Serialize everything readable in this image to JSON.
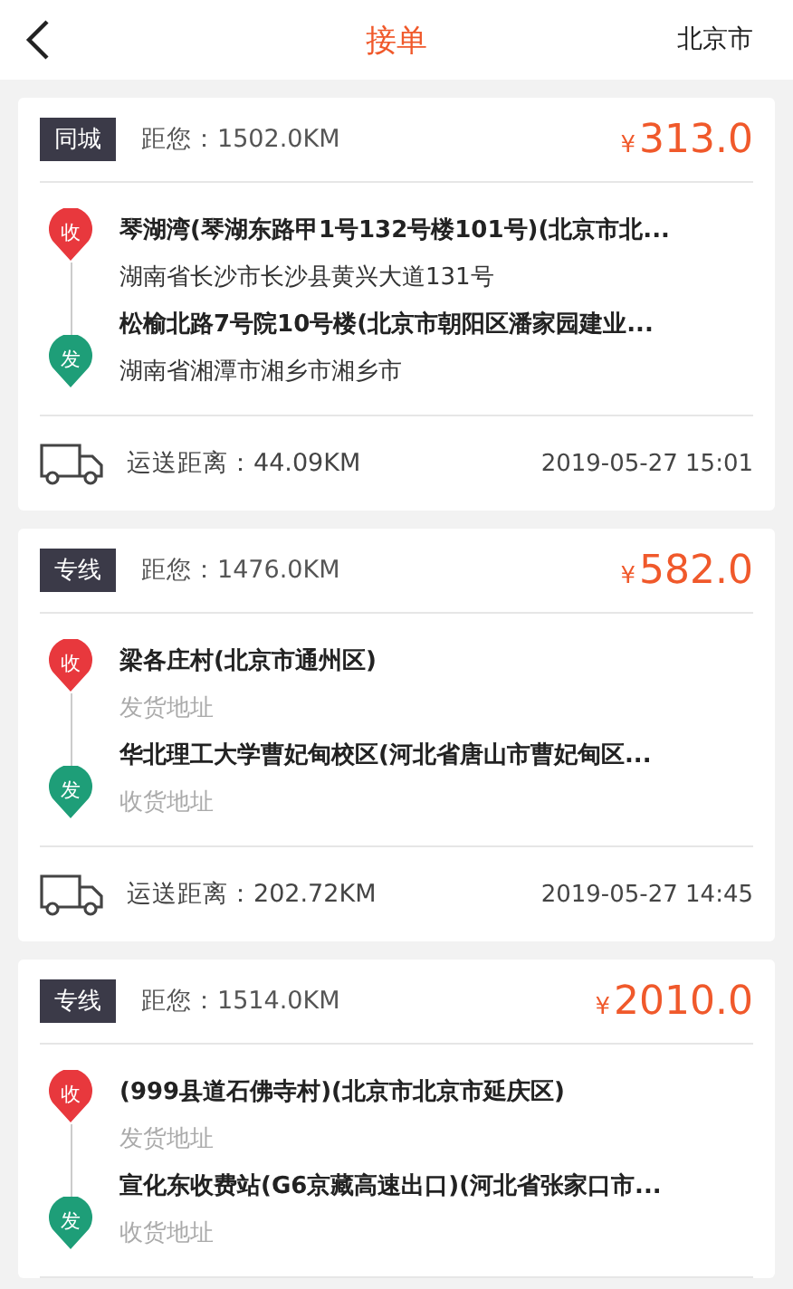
{
  "header": {
    "title": "接单",
    "city": "北京市"
  },
  "orders": [
    {
      "tag": "同城",
      "distance": "距您：1502.0KM",
      "currency": "¥",
      "price": "313.0",
      "stops": [
        {
          "pin": "收",
          "color": "#e8383d",
          "address": "琴湖湾(琴湖东路甲1号132号楼101号)(北京市北...",
          "detail": "湖南省长沙市长沙县黄兴大道131号",
          "muted": false
        },
        {
          "pin": "发",
          "color": "#1e9e78",
          "address": "松榆北路7号院10号楼(北京市朝阳区潘家园建业...",
          "detail": "湖南省湘潭市湘乡市湘乡市",
          "muted": false
        }
      ],
      "route": "运送距离：44.09KM",
      "time": "2019-05-27 15:01"
    },
    {
      "tag": "专线",
      "distance": "距您：1476.0KM",
      "currency": "¥",
      "price": "582.0",
      "stops": [
        {
          "pin": "收",
          "color": "#e8383d",
          "address": "梁各庄村(北京市通州区)",
          "detail": "发货地址",
          "muted": true
        },
        {
          "pin": "发",
          "color": "#1e9e78",
          "address": "华北理工大学曹妃甸校区(河北省唐山市曹妃甸区...",
          "detail": "收货地址",
          "muted": true
        }
      ],
      "route": "运送距离：202.72KM",
      "time": "2019-05-27 14:45"
    },
    {
      "tag": "专线",
      "distance": "距您：1514.0KM",
      "currency": "¥",
      "price": "2010.0",
      "stops": [
        {
          "pin": "收",
          "color": "#e8383d",
          "address": "(999县道石佛寺村)(北京市北京市延庆区)",
          "detail": "发货地址",
          "muted": true
        },
        {
          "pin": "发",
          "color": "#1e9e78",
          "address": "宣化东收费站(G6京藏高速出口)(河北省张家口市...",
          "detail": "收货地址",
          "muted": true
        }
      ]
    }
  ]
}
